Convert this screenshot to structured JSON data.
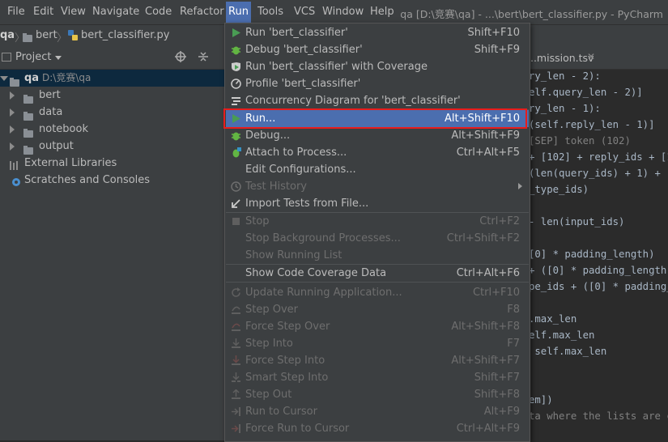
{
  "menubar": {
    "items": [
      "File",
      "Edit",
      "View",
      "Navigate",
      "Code",
      "Refactor",
      "Run",
      "Tools",
      "VCS",
      "Window",
      "Help"
    ],
    "active": "Run",
    "window_title": "qa [D:\\竞赛\\qa] - ...\\bert\\bert_classifier.py - PyCharm"
  },
  "navbar": {
    "crumbs": [
      "qa",
      "bert",
      "bert_classifier.py"
    ]
  },
  "project_panel": {
    "title": "Project",
    "root_name": "qa",
    "root_path": "D:\\竞赛\\qa",
    "folders": [
      "bert",
      "data",
      "notebook",
      "output"
    ],
    "external_libraries": "External Libraries",
    "scratches": "Scratches and Consoles"
  },
  "editor": {
    "tab_name": "...mission.tsv",
    "lines": [
      "ry_len - 2):",
      "elf.query_len - 2)]",
      "ry_len - 1):",
      "(self.reply_len - 1)]",
      "[SEP] token (102)",
      "+ [102] + reply_ids + [1",
      "(len(query_ids) + 1) + [1",
      "_type_ids)",
      "",
      "- len(input_ids)",
      "",
      "[0] * padding_length)",
      "+ ([0] * padding_length)",
      "pe_ids + ([0] * padding_l",
      "",
      ".max_len",
      "elf.max_len",
      " self.max_len",
      "",
      "",
      "em])",
      "ta where the lists are co"
    ]
  },
  "run_menu": {
    "items": [
      {
        "label": "Run 'bert_classifier'",
        "shortcut": "Shift+F10",
        "icon": "run-green-icon",
        "enabled": true
      },
      {
        "label": "Debug 'bert_classifier'",
        "shortcut": "Shift+F9",
        "icon": "debug-bug-icon",
        "enabled": true
      },
      {
        "label": "Run 'bert_classifier' with Coverage",
        "shortcut": "",
        "icon": "coverage-icon",
        "enabled": true
      },
      {
        "label": "Profile 'bert_classifier'",
        "shortcut": "",
        "icon": "profile-icon",
        "enabled": true
      },
      {
        "label": "Concurrency Diagram for 'bert_classifier'",
        "shortcut": "",
        "icon": "concurrency-icon",
        "enabled": true
      },
      {
        "label": "Run...",
        "shortcut": "Alt+Shift+F10",
        "icon": "run-green-icon",
        "enabled": true,
        "highlighted": true
      },
      {
        "label": "Debug...",
        "shortcut": "Alt+Shift+F9",
        "icon": "debug-bug-icon",
        "enabled": true
      },
      {
        "label": "Attach to Process...",
        "shortcut": "Ctrl+Alt+F5",
        "icon": "attach-bug-icon",
        "enabled": true
      },
      {
        "label": "Edit Configurations...",
        "shortcut": "",
        "icon": "",
        "enabled": true
      },
      {
        "label": "Test History",
        "shortcut": "",
        "icon": "history-clock-icon",
        "enabled": false,
        "submenu": true
      },
      {
        "label": "Import Tests from File...",
        "shortcut": "",
        "icon": "import-arrow-icon",
        "enabled": true
      },
      {
        "label": "Stop",
        "shortcut": "Ctrl+F2",
        "icon": "stop-square-icon",
        "enabled": false
      },
      {
        "label": "Stop Background Processes...",
        "shortcut": "Ctrl+Shift+F2",
        "icon": "",
        "enabled": false
      },
      {
        "label": "Show Running List",
        "shortcut": "",
        "icon": "",
        "enabled": false
      },
      {
        "label": "Show Code Coverage Data",
        "shortcut": "Ctrl+Alt+F6",
        "icon": "",
        "enabled": true
      },
      {
        "label": "Update Running Application...",
        "shortcut": "Ctrl+F10",
        "icon": "update-refresh-icon",
        "enabled": false
      },
      {
        "label": "Step Over",
        "shortcut": "F8",
        "icon": "step-over-icon",
        "enabled": false
      },
      {
        "label": "Force Step Over",
        "shortcut": "Alt+Shift+F8",
        "icon": "force-step-over-icon",
        "enabled": false
      },
      {
        "label": "Step Into",
        "shortcut": "F7",
        "icon": "step-into-icon",
        "enabled": false
      },
      {
        "label": "Force Step Into",
        "shortcut": "Alt+Shift+F7",
        "icon": "force-step-into-icon",
        "enabled": false
      },
      {
        "label": "Smart Step Into",
        "shortcut": "Shift+F7",
        "icon": "smart-step-into-icon",
        "enabled": false
      },
      {
        "label": "Step Out",
        "shortcut": "Shift+F8",
        "icon": "step-out-icon",
        "enabled": false
      },
      {
        "label": "Run to Cursor",
        "shortcut": "Alt+F9",
        "icon": "run-to-cursor-icon",
        "enabled": false
      },
      {
        "label": "Force Run to Cursor",
        "shortcut": "Ctrl+Alt+F9",
        "icon": "force-run-to-cursor-icon",
        "enabled": false
      }
    ]
  },
  "colors": {
    "highlight": "#4b6eaf",
    "run_green": "#499c54",
    "debug_green": "#62b543",
    "callout_red": "#e81c1c"
  }
}
